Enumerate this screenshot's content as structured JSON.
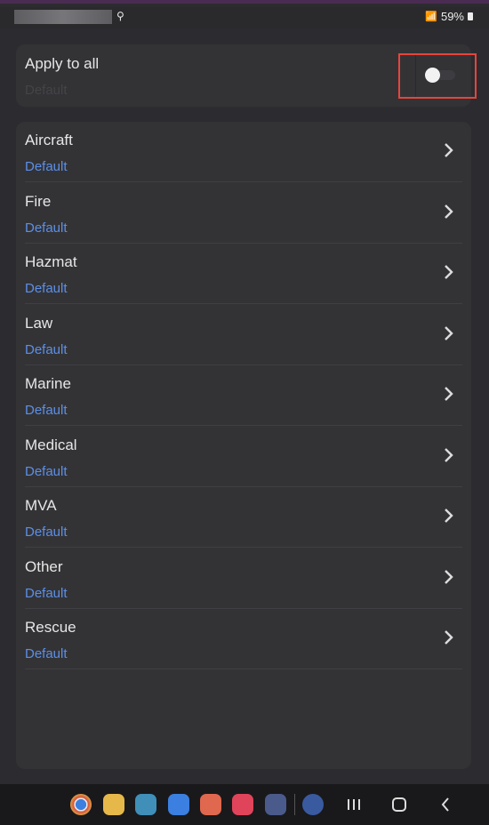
{
  "status_bar": {
    "battery": "59%",
    "icons": [
      "key-icon",
      "wifi-icon",
      "battery-icon"
    ]
  },
  "apply_all": {
    "title": "Apply to all",
    "subtitle": "Default",
    "toggle_on": false
  },
  "categories": [
    {
      "title": "Aircraft",
      "value": "Default"
    },
    {
      "title": "Fire",
      "value": "Default"
    },
    {
      "title": "Hazmat",
      "value": "Default"
    },
    {
      "title": "Law",
      "value": "Default"
    },
    {
      "title": "Marine",
      "value": "Default"
    },
    {
      "title": "Medical",
      "value": "Default"
    },
    {
      "title": "MVA",
      "value": "Default"
    },
    {
      "title": "Other",
      "value": "Default"
    },
    {
      "title": "Rescue",
      "value": "Default"
    }
  ],
  "dock_apps": [
    {
      "name": "chrome-icon",
      "color": "#e0c24a"
    },
    {
      "name": "files-icon",
      "color": "#e6b84a"
    },
    {
      "name": "calendar-icon",
      "color": "#3f8fb8"
    },
    {
      "name": "messages-icon",
      "color": "#3b7fe0"
    },
    {
      "name": "contacts-icon",
      "color": "#e0684e"
    },
    {
      "name": "camera-icon",
      "color": "#e0445a"
    },
    {
      "name": "apps-grid-icon",
      "color": "#4a5a8a"
    },
    {
      "name": "settings-icon",
      "color": "#3a5aa0"
    }
  ],
  "colors": {
    "accent_link": "#5d8fe6",
    "highlight": "#e8443c"
  }
}
